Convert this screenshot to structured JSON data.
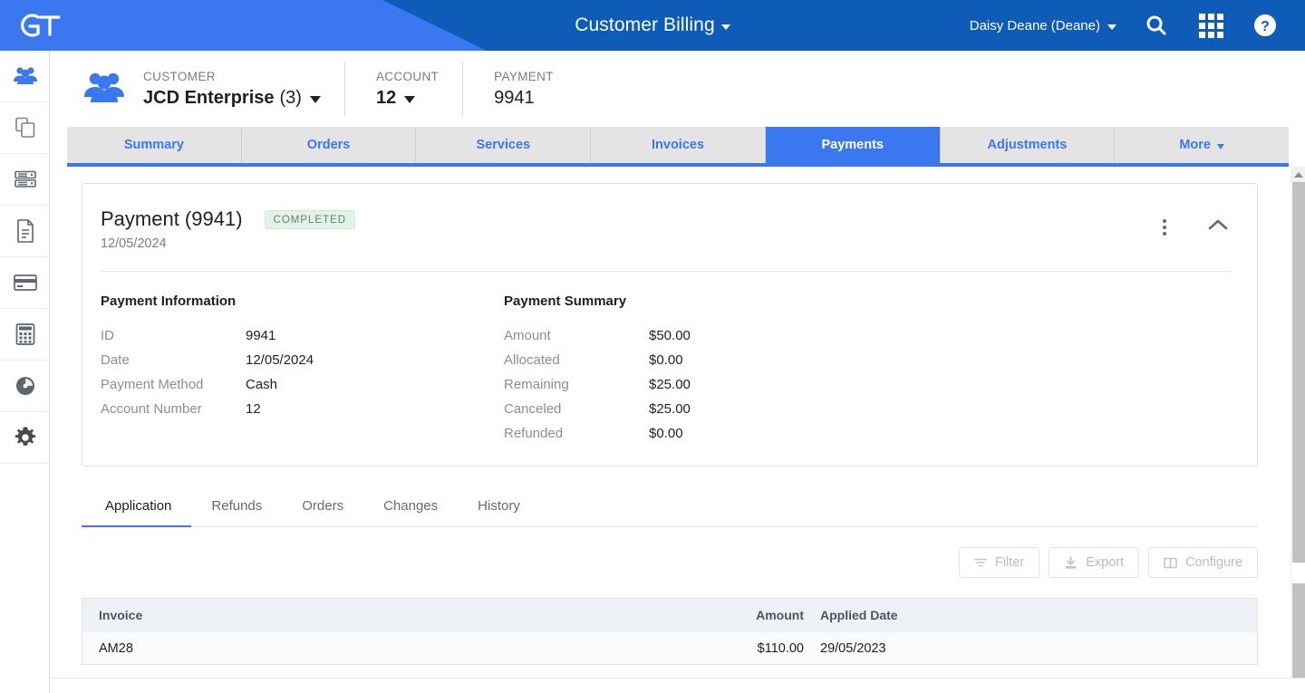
{
  "topbar": {
    "logo_text": "GT",
    "title": "Customer Billing",
    "user": "Daisy Deane (Deane)",
    "search_icon": "search-icon",
    "apps_icon": "apps-grid-icon",
    "help_icon": "help-circle-icon",
    "color_light": "#3b78f0",
    "color_dark": "#0f5cb8"
  },
  "rail": {
    "items": [
      {
        "icon": "customers-icon",
        "active": true
      },
      {
        "icon": "copy-documents-icon",
        "active": false
      },
      {
        "icon": "server-stack-icon",
        "active": false
      },
      {
        "icon": "document-icon",
        "active": false
      },
      {
        "icon": "credit-card-icon",
        "active": false
      },
      {
        "icon": "calculator-icon",
        "active": false
      },
      {
        "icon": "speedometer-icon",
        "active": false
      },
      {
        "icon": "gear-icon",
        "active": false
      }
    ]
  },
  "breadcrumb": {
    "customer": {
      "label": "CUSTOMER",
      "name": "JCD Enterprise",
      "count": "(3)"
    },
    "account": {
      "label": "ACCOUNT",
      "value": "12"
    },
    "payment": {
      "label": "PAYMENT",
      "value": "9941"
    }
  },
  "tabs": [
    {
      "label": "Summary",
      "active": false
    },
    {
      "label": "Orders",
      "active": false
    },
    {
      "label": "Services",
      "active": false
    },
    {
      "label": "Invoices",
      "active": false
    },
    {
      "label": "Payments",
      "active": true
    },
    {
      "label": "Adjustments",
      "active": false
    },
    {
      "label": "More",
      "active": false,
      "dropdown": true
    }
  ],
  "card": {
    "title": "Payment (9941)",
    "status": "COMPLETED",
    "status_bg": "#e2f3e8",
    "date": "12/05/2024",
    "menu_icon": "kebab-menu-icon",
    "collapse_icon": "chevron-up-icon",
    "payment_information": {
      "heading": "Payment Information",
      "rows": [
        {
          "label": "ID",
          "value": "9941"
        },
        {
          "label": "Date",
          "value": "12/05/2024"
        },
        {
          "label": "Payment Method",
          "value": "Cash"
        },
        {
          "label": "Account Number",
          "value": "12"
        }
      ]
    },
    "payment_summary": {
      "heading": "Payment Summary",
      "rows": [
        {
          "label": "Amount",
          "value": "$50.00"
        },
        {
          "label": "Allocated",
          "value": "$0.00"
        },
        {
          "label": "Remaining",
          "value": "$25.00"
        },
        {
          "label": "Canceled",
          "value": "$25.00"
        },
        {
          "label": "Refunded",
          "value": "$0.00"
        }
      ]
    }
  },
  "subtabs": [
    {
      "label": "Application",
      "active": true
    },
    {
      "label": "Refunds",
      "active": false
    },
    {
      "label": "Orders",
      "active": false
    },
    {
      "label": "Changes",
      "active": false
    },
    {
      "label": "History",
      "active": false
    }
  ],
  "toolbar": [
    {
      "label": "Filter",
      "icon": "filter-icon"
    },
    {
      "label": "Export",
      "icon": "download-icon"
    },
    {
      "label": "Configure",
      "icon": "columns-icon"
    }
  ],
  "table": {
    "headers": {
      "invoice": "Invoice",
      "amount": "Amount",
      "applied_date": "Applied Date"
    },
    "rows": [
      {
        "invoice": "AM28",
        "amount": "$110.00",
        "applied_date": "29/05/2023"
      }
    ]
  }
}
